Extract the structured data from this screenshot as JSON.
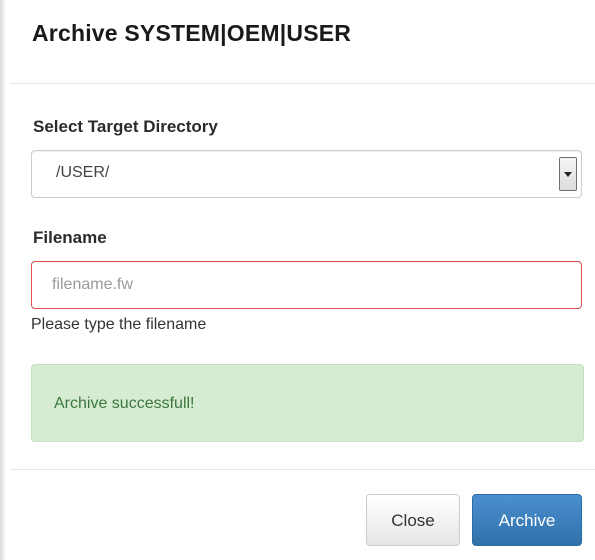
{
  "dialog": {
    "title": "Archive SYSTEM|OEM|USER"
  },
  "target_directory": {
    "label": "Select Target Directory",
    "selected_value": "/USER/"
  },
  "filename": {
    "label": "Filename",
    "value": "",
    "placeholder": "filename.fw",
    "help_text": "Please type the filename"
  },
  "alert": {
    "message": "Archive successfull!"
  },
  "footer": {
    "close_label": "Close",
    "archive_label": "Archive"
  },
  "colors": {
    "primary_button": "#3071a9",
    "success_background": "#d6ecd2",
    "success_text": "#3c763d",
    "error_border": "#d9534f"
  },
  "icons": {
    "select_arrow": "chevron-down-icon"
  }
}
